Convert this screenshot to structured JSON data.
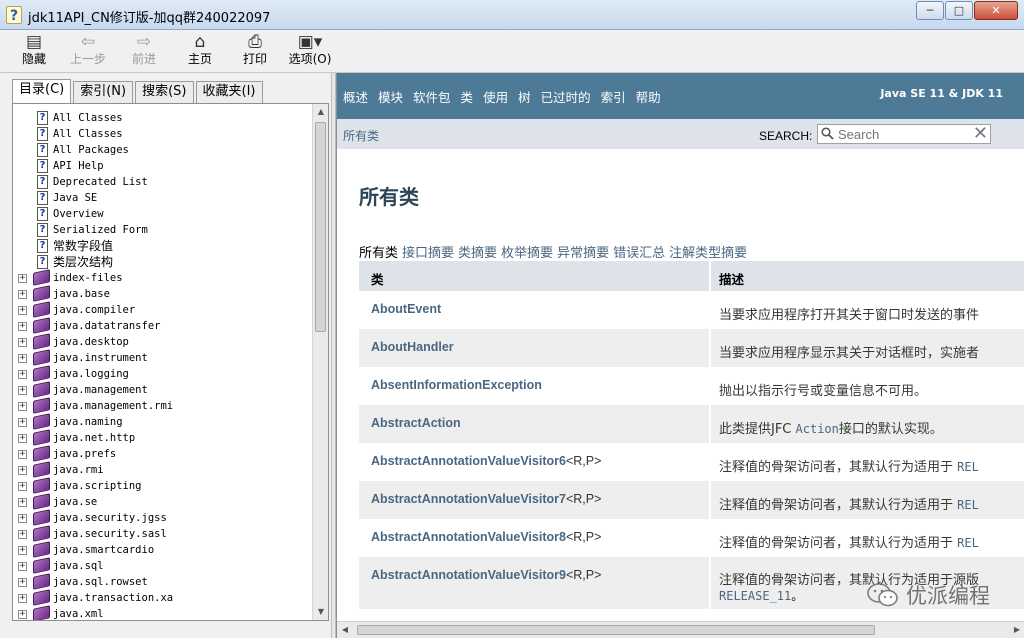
{
  "window": {
    "title": "jdk11API_CN修订版-加qq群240022097",
    "icon": "help-file-icon",
    "controls": {
      "minimize": "minimize-icon",
      "maximize": "maximize-icon",
      "close": "close-icon"
    }
  },
  "toolbar": {
    "hide": "隐藏",
    "back": "上一步",
    "forward": "前进",
    "home": "主页",
    "print": "打印",
    "options": "选项(O)"
  },
  "nav": {
    "tabs": [
      "目录(C)",
      "索引(N)",
      "搜索(S)",
      "收藏夹(I)"
    ],
    "active_tab": "目录(C)",
    "tree": [
      {
        "label": "All Classes",
        "type": "page",
        "selected": true
      },
      {
        "label": "All Classes",
        "type": "page"
      },
      {
        "label": "All Packages",
        "type": "page"
      },
      {
        "label": "API Help",
        "type": "page"
      },
      {
        "label": "Deprecated List",
        "type": "page"
      },
      {
        "label": "Java SE",
        "type": "page"
      },
      {
        "label": "Overview",
        "type": "page"
      },
      {
        "label": "Serialized Form",
        "type": "page"
      },
      {
        "label": "常数字段值",
        "type": "page"
      },
      {
        "label": "类层次结构",
        "type": "page"
      },
      {
        "label": "index-files",
        "type": "book"
      },
      {
        "label": "java.base",
        "type": "book"
      },
      {
        "label": "java.compiler",
        "type": "book"
      },
      {
        "label": "java.datatransfer",
        "type": "book"
      },
      {
        "label": "java.desktop",
        "type": "book"
      },
      {
        "label": "java.instrument",
        "type": "book"
      },
      {
        "label": "java.logging",
        "type": "book"
      },
      {
        "label": "java.management",
        "type": "book"
      },
      {
        "label": "java.management.rmi",
        "type": "book"
      },
      {
        "label": "java.naming",
        "type": "book"
      },
      {
        "label": "java.net.http",
        "type": "book"
      },
      {
        "label": "java.prefs",
        "type": "book"
      },
      {
        "label": "java.rmi",
        "type": "book"
      },
      {
        "label": "java.scripting",
        "type": "book"
      },
      {
        "label": "java.se",
        "type": "book"
      },
      {
        "label": "java.security.jgss",
        "type": "book"
      },
      {
        "label": "java.security.sasl",
        "type": "book"
      },
      {
        "label": "java.smartcardio",
        "type": "book"
      },
      {
        "label": "java.sql",
        "type": "book"
      },
      {
        "label": "java.sql.rowset",
        "type": "book"
      },
      {
        "label": "java.transaction.xa",
        "type": "book"
      },
      {
        "label": "java.xml",
        "type": "book"
      }
    ]
  },
  "content": {
    "topnav": [
      "概述",
      "模块",
      "软件包",
      "类",
      "使用",
      "树",
      "已过时的",
      "索引",
      "帮助"
    ],
    "brand": "Java SE 11 & JDK 11",
    "breadcrumb": "所有类",
    "search_label": "SEARCH:",
    "search_placeholder": "Search",
    "page_title": "所有类",
    "summary_current": "所有类",
    "summary_links": [
      "接口摘要",
      "类摘要",
      "枚举摘要",
      "异常摘要",
      "错误汇总",
      "注解类型摘要"
    ],
    "table": {
      "headers": [
        "类",
        "描述"
      ],
      "rows": [
        {
          "name": "AboutEvent",
          "params": "",
          "desc": "当要求应用程序打开其关于窗口时发送的事件"
        },
        {
          "name": "AboutHandler",
          "params": "",
          "desc": "当要求应用程序显示其关于对话框时，实施者"
        },
        {
          "name": "AbsentInformationException",
          "params": "",
          "desc": "抛出以指示行号或变量信息不可用。"
        },
        {
          "name": "AbstractAction",
          "params": "",
          "desc_pre": "此类提供JFC ",
          "desc_code": "Action",
          "desc_post": "接口的默认实现。"
        },
        {
          "name": "AbstractAnnotationValueVisitor6",
          "params": "<R,P>",
          "desc_pre": "注释值的骨架访问者，其默认行为适用于 ",
          "desc_code": "REL"
        },
        {
          "name": "AbstractAnnotationValueVisitor7",
          "params": "<R,P>",
          "desc_pre": "注释值的骨架访问者，其默认行为适用于 ",
          "desc_code": "REL"
        },
        {
          "name": "AbstractAnnotationValueVisitor8",
          "params": "<R,P>",
          "desc_pre": "注释值的骨架访问者，其默认行为适用于 ",
          "desc_code": "REL"
        },
        {
          "name": "AbstractAnnotationValueVisitor9",
          "params": "<R,P>",
          "desc_pre": "注释值的骨架访问者，其默认行为适用于源版",
          "desc_line2": "RELEASE_11",
          "desc_line2_post": "。"
        }
      ]
    },
    "watermark": "优派编程"
  },
  "colors": {
    "topnav_bg": "#4d7a97",
    "subnav_bg": "#dee3e9",
    "link": "#4a6782",
    "row_alt": "#eeeeef"
  }
}
